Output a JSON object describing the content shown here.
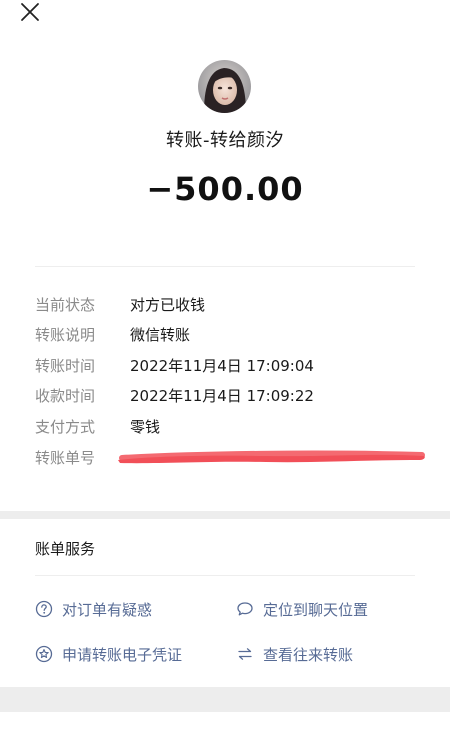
{
  "header": {
    "close_icon": "close-icon",
    "title": "转账-转给颜汐",
    "amount": "−500.00"
  },
  "details": [
    {
      "label": "当前状态",
      "value": "对方已收钱"
    },
    {
      "label": "转账说明",
      "value": "微信转账"
    },
    {
      "label": "转账时间",
      "value": "2022年11月4日 17:09:04"
    },
    {
      "label": "收款时间",
      "value": "2022年11月4日 17:09:22"
    },
    {
      "label": "支付方式",
      "value": "零钱"
    },
    {
      "label": "转账单号",
      "value": ""
    }
  ],
  "services": {
    "title": "账单服务",
    "items": [
      {
        "label": "对订单有疑惑",
        "icon": "question-circle-icon"
      },
      {
        "label": "定位到聊天位置",
        "icon": "chat-bubble-icon"
      },
      {
        "label": "申请转账电子凭证",
        "icon": "star-badge-icon"
      },
      {
        "label": "查看往来转账",
        "icon": "swap-arrows-icon"
      }
    ]
  },
  "colors": {
    "link": "#576b95",
    "label_gray": "#8a8a8a",
    "section_gap": "#ededed",
    "redaction": "#f0404a"
  }
}
